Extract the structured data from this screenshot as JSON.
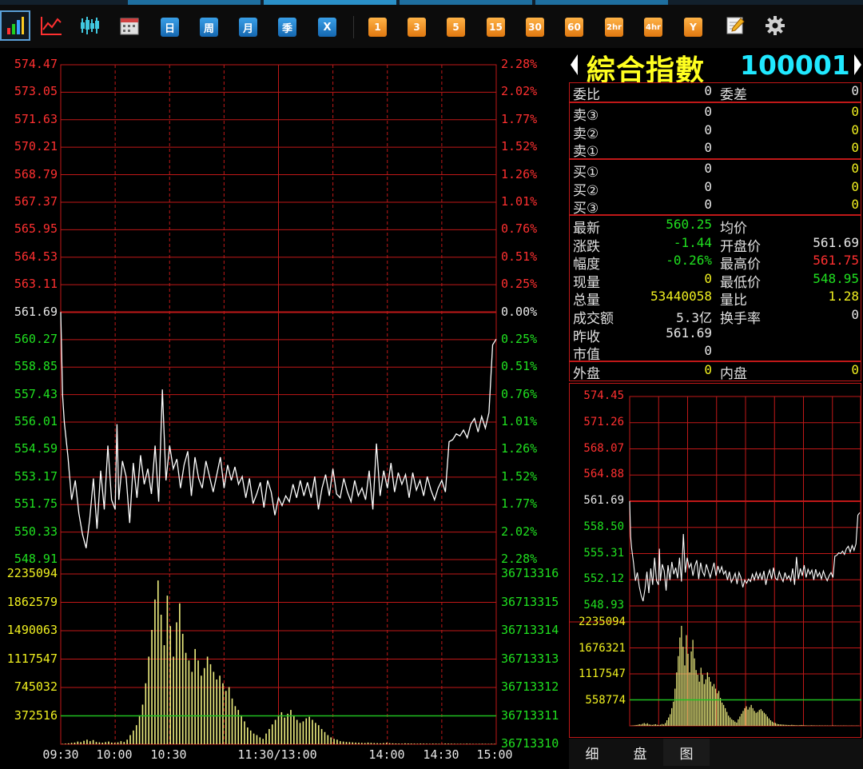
{
  "toolbar": {
    "period_buttons": [
      "日",
      "周",
      "月",
      "季",
      "X"
    ],
    "minute_buttons": [
      "1",
      "3",
      "5",
      "15",
      "30",
      "60",
      "2hr",
      "4hr",
      "Y"
    ]
  },
  "stock": {
    "name": "綜合指數",
    "code": "100001"
  },
  "order_book": {
    "ratio_label": "委比",
    "ratio_value": "0",
    "diff_label": "委差",
    "diff_value": "0",
    "sells": [
      {
        "label": "卖③",
        "price": "0",
        "vol": "0"
      },
      {
        "label": "卖②",
        "price": "0",
        "vol": "0"
      },
      {
        "label": "卖①",
        "price": "0",
        "vol": "0"
      }
    ],
    "buys": [
      {
        "label": "买①",
        "price": "0",
        "vol": "0"
      },
      {
        "label": "买②",
        "price": "0",
        "vol": "0"
      },
      {
        "label": "买③",
        "price": "0",
        "vol": "0"
      }
    ]
  },
  "quote": {
    "rows": [
      {
        "l1": "最新",
        "v1": "560.25",
        "l2": "均价",
        "v2": ""
      },
      {
        "l1": "涨跌",
        "v1": "-1.44",
        "l2": "开盘价",
        "v2": "561.69"
      },
      {
        "l1": "幅度",
        "v1": "-0.26%",
        "l2": "最高价",
        "v2": "561.75"
      },
      {
        "l1": "现量",
        "v1": "0",
        "l2": "最低价",
        "v2": "548.95"
      },
      {
        "l1": "总量",
        "v1": "53440058",
        "l2": "量比",
        "v2": "1.28"
      },
      {
        "l1": "成交额",
        "v1": "5.3亿",
        "l2": "换手率",
        "v2": "0"
      },
      {
        "l1": "昨收",
        "v1": "561.69",
        "l2": "",
        "v2": ""
      },
      {
        "l1": "市值",
        "v1": "0",
        "l2": "",
        "v2": ""
      }
    ],
    "outer_label": "外盘",
    "outer_value": "0",
    "inner_label": "内盘",
    "inner_value": "0"
  },
  "tabs": [
    "细",
    "盘",
    "图"
  ],
  "colors": {
    "up": "#ff3030",
    "down": "#20e020",
    "grid": "#c01818",
    "price_line": "#ffffff",
    "volume_bar": "#f0f080",
    "volume_avg_line": "#20c020"
  },
  "chart_data": [
    {
      "type": "line",
      "name": "intraday-price",
      "prev_close": 561.69,
      "ylim": [
        548.91,
        574.47
      ],
      "price_ticks_left": [
        "574.47",
        "573.05",
        "571.63",
        "570.21",
        "568.79",
        "567.37",
        "565.95",
        "564.53",
        "563.11",
        "561.69",
        "560.27",
        "558.85",
        "557.43",
        "556.01",
        "554.59",
        "553.17",
        "551.75",
        "550.33",
        "548.91"
      ],
      "pct_ticks_right": [
        "2.28%",
        "2.02%",
        "1.77%",
        "1.52%",
        "1.26%",
        "1.01%",
        "0.76%",
        "0.51%",
        "0.25%",
        "0.00%",
        "0.25%",
        "0.51%",
        "0.76%",
        "1.01%",
        "1.26%",
        "1.52%",
        "1.77%",
        "2.02%",
        "2.28%"
      ],
      "x_labels": [
        "09:30",
        "10:00",
        "10:30",
        "11:30/13:00",
        "14:00",
        "14:30",
        "15:00"
      ],
      "x_minutes": [
        0,
        240
      ],
      "x": [
        0,
        1,
        2,
        4,
        6,
        8,
        10,
        12,
        14,
        16,
        18,
        20,
        22,
        24,
        26,
        28,
        30,
        31,
        32,
        34,
        36,
        38,
        40,
        42,
        44,
        46,
        48,
        50,
        52,
        54,
        56,
        58,
        60,
        62,
        64,
        66,
        68,
        70,
        72,
        74,
        76,
        78,
        80,
        82,
        84,
        86,
        88,
        90,
        92,
        94,
        96,
        98,
        100,
        102,
        104,
        106,
        108,
        110,
        112,
        114,
        116,
        118,
        120,
        122,
        124,
        126,
        128,
        130,
        132,
        134,
        136,
        138,
        140,
        142,
        144,
        146,
        148,
        150,
        152,
        154,
        156,
        158,
        160,
        162,
        164,
        166,
        168,
        170,
        172,
        174,
        176,
        178,
        180,
        182,
        184,
        186,
        188,
        190,
        192,
        194,
        196,
        198,
        200,
        202,
        204,
        206,
        208,
        210,
        212,
        214,
        216,
        218,
        220,
        222,
        224,
        226,
        228,
        230,
        232,
        234,
        236,
        238,
        240
      ],
      "y": [
        561.7,
        557.4,
        556.0,
        554.2,
        552.0,
        553.0,
        551.3,
        550.2,
        549.5,
        551.0,
        553.1,
        550.5,
        553.5,
        551.5,
        554.8,
        552.0,
        551.5,
        555.9,
        552.0,
        554.0,
        553.2,
        550.8,
        553.9,
        552.1,
        554.3,
        552.8,
        553.6,
        552.3,
        554.8,
        551.9,
        557.7,
        553.0,
        554.8,
        553.6,
        554.1,
        552.6,
        553.8,
        554.5,
        552.2,
        554.2,
        553.1,
        552.6,
        554.0,
        553.2,
        552.4,
        553.3,
        554.2,
        552.6,
        553.8,
        553.0,
        553.7,
        552.8,
        553.2,
        552.1,
        553.1,
        551.8,
        552.3,
        552.9,
        551.6,
        553.0,
        552.4,
        551.2,
        552.1,
        551.7,
        552.2,
        551.9,
        552.8,
        552.1,
        553.0,
        552.2,
        552.9,
        552.1,
        553.2,
        551.5,
        552.6,
        553.3,
        552.2,
        553.6,
        552.3,
        552.1,
        553.1,
        552.4,
        551.9,
        553.0,
        552.2,
        552.6,
        552.0,
        553.5,
        551.5,
        554.9,
        552.2,
        553.5,
        552.6,
        553.9,
        552.4,
        553.4,
        552.8,
        553.3,
        552.1,
        553.4,
        552.5,
        553.0,
        552.2,
        553.2,
        552.5,
        552.0,
        552.6,
        553.0,
        552.4,
        555.0,
        555.1,
        555.4,
        555.3,
        555.6,
        555.2,
        555.9,
        556.2,
        555.5,
        556.3,
        555.7,
        556.5,
        560.0,
        560.3
      ]
    },
    {
      "type": "bar",
      "name": "intraday-volume",
      "ylim": [
        0,
        2235094
      ],
      "vol_ticks_left": [
        "2235094",
        "1862579",
        "1490063",
        "1117547",
        "745032",
        "372516"
      ],
      "vol_ticks_right": [
        "36713316",
        "36713315",
        "36713314",
        "36713313",
        "36713312",
        "36713311",
        "36713310"
      ],
      "avg_line_value": 372516,
      "values": [
        5000,
        8000,
        12000,
        18000,
        22000,
        35000,
        28000,
        45000,
        60000,
        40000,
        55000,
        30000,
        25000,
        20000,
        28000,
        35000,
        22000,
        18000,
        25000,
        40000,
        30000,
        60000,
        120000,
        180000,
        250000,
        380000,
        520000,
        800000,
        1150000,
        1500000,
        1900000,
        2150000,
        1700000,
        1300000,
        1950000,
        1550000,
        1150000,
        1600000,
        1850000,
        1450000,
        1200000,
        1100000,
        950000,
        1250000,
        1100000,
        900000,
        1000000,
        1150000,
        1050000,
        950000,
        850000,
        900000,
        800000,
        700000,
        750000,
        600000,
        500000,
        450000,
        380000,
        300000,
        220000,
        180000,
        140000,
        120000,
        90000,
        70000,
        140000,
        200000,
        260000,
        320000,
        380000,
        420000,
        350000,
        400000,
        450000,
        380000,
        320000,
        280000,
        300000,
        340000,
        360000,
        320000,
        280000,
        250000,
        200000,
        160000,
        120000,
        90000,
        70000,
        60000,
        40000,
        35000,
        30000,
        28000,
        25000,
        22000,
        20000,
        18000,
        16000,
        22000,
        18000,
        15000,
        14000,
        12000,
        15000,
        18000,
        14000,
        12000,
        10000,
        9000,
        8000,
        12000,
        10000,
        9000,
        8000,
        7000,
        9000,
        8000,
        7000,
        6000,
        8000,
        7000,
        6000,
        5000,
        9000,
        8000,
        7000,
        6000,
        5000,
        6000,
        5000,
        7000,
        6000,
        5000,
        4000,
        5000,
        6000,
        5000,
        4000,
        6000,
        5000
      ]
    },
    {
      "type": "line",
      "name": "mini-price",
      "ylim": [
        548.93,
        574.45
      ],
      "ticks": [
        "574.45",
        "571.26",
        "568.07",
        "564.88",
        "561.69",
        "558.50",
        "555.31",
        "552.12",
        "548.93"
      ],
      "tick_colors": [
        "red",
        "red",
        "red",
        "red",
        "white",
        "green",
        "green",
        "green",
        "green"
      ]
    },
    {
      "type": "bar",
      "name": "mini-volume",
      "ylim": [
        0,
        2235094
      ],
      "ticks": [
        "2235094",
        "1676321",
        "1117547",
        "558774"
      ],
      "avg_line_value": 558774
    }
  ]
}
